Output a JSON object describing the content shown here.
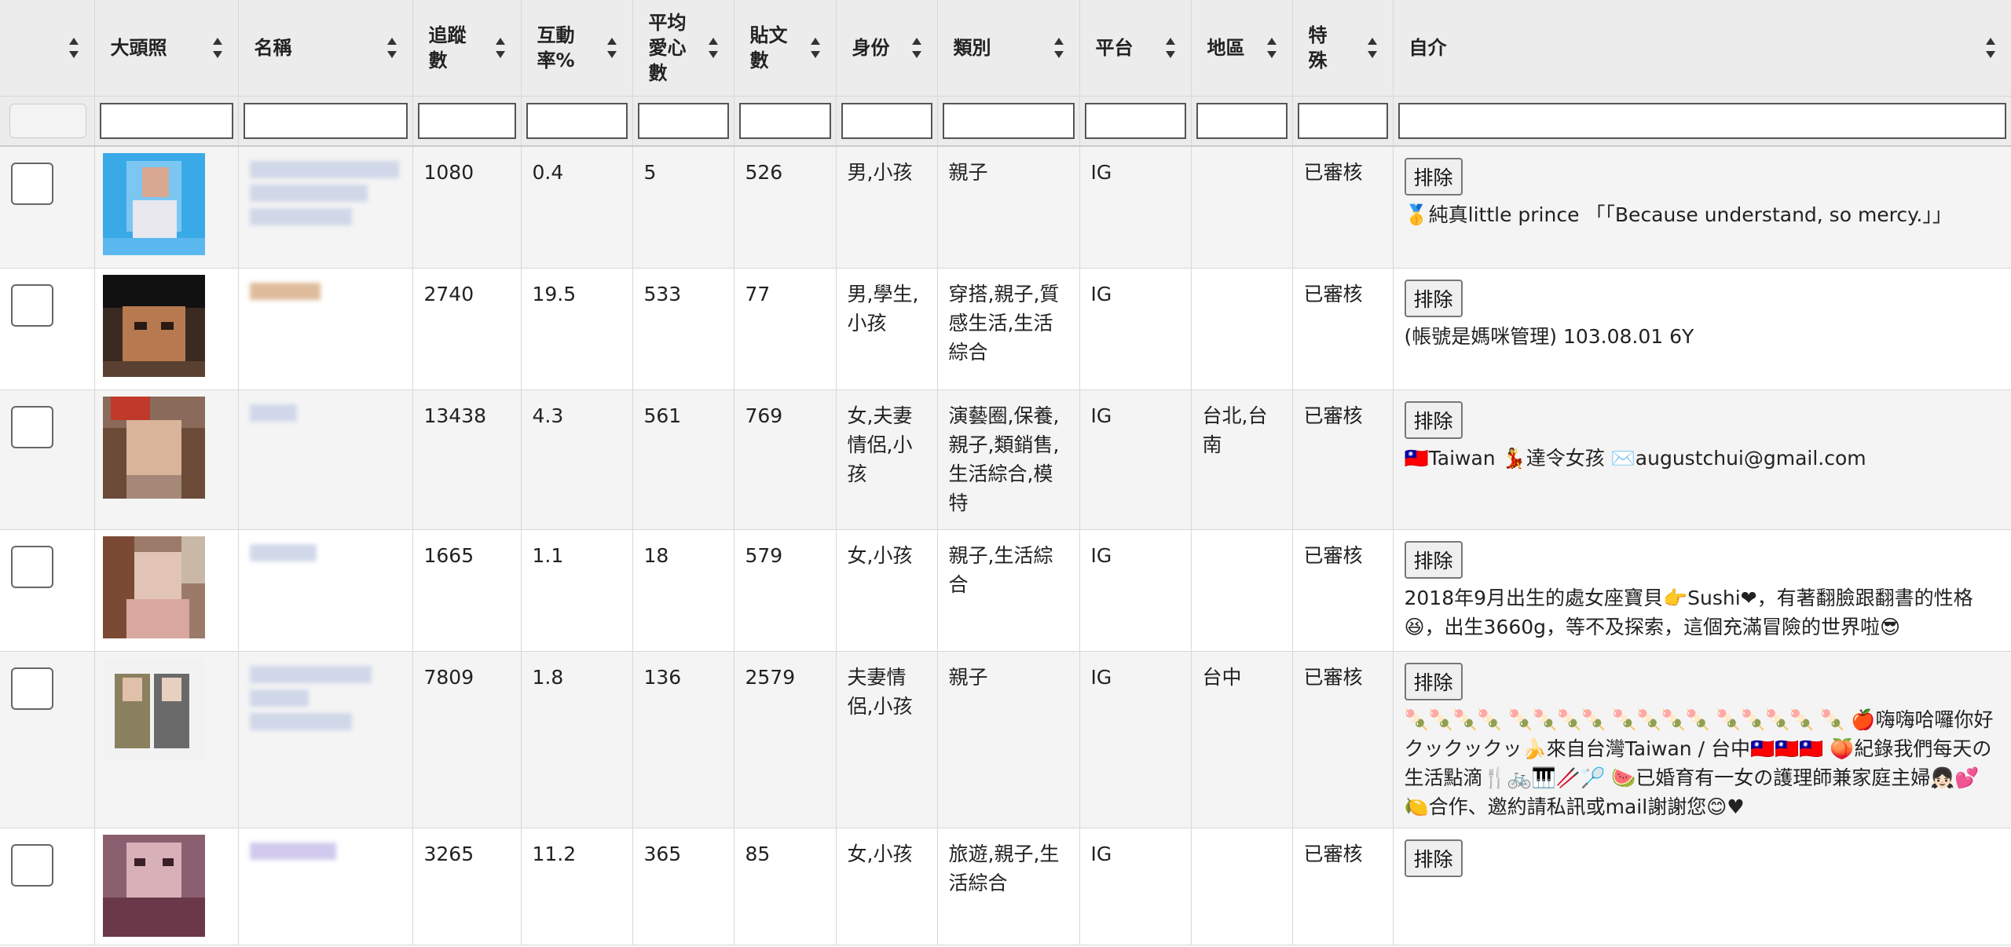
{
  "columns": {
    "avatar": "大頭照",
    "name": "名稱",
    "followers": "追蹤數",
    "engagement": "互動率%",
    "avg_likes": "平均愛心數",
    "posts": "貼文數",
    "identity": "身份",
    "category": "類別",
    "platform": "平台",
    "region": "地區",
    "special": "特殊",
    "bio": "自介"
  },
  "remove_label": "排除",
  "rows": [
    {
      "followers": "1080",
      "engagement": "0.4",
      "avg_likes": "5",
      "posts": "526",
      "identity": "男,小孩",
      "category": "親子",
      "platform": "IG",
      "region": "",
      "special": "已審核",
      "bio": "🥇純真little prince 「「Because understand, so mercy.」」"
    },
    {
      "followers": "2740",
      "engagement": "19.5",
      "avg_likes": "533",
      "posts": "77",
      "identity": "男,學生,小孩",
      "category": "穿搭,親子,質感生活,生活綜合",
      "platform": "IG",
      "region": "",
      "special": "已審核",
      "bio": "(帳號是媽咪管理) 103.08.01 6Y"
    },
    {
      "followers": "13438",
      "engagement": "4.3",
      "avg_likes": "561",
      "posts": "769",
      "identity": "女,夫妻情侶,小孩",
      "category": "演藝圈,保養,親子,類銷售,生活綜合,模特",
      "platform": "IG",
      "region": "台北,台南",
      "special": "已審核",
      "bio": "🇹🇼Taiwan 💃達令女孩 ✉️augustchui@gmail.com"
    },
    {
      "followers": "1665",
      "engagement": "1.1",
      "avg_likes": "18",
      "posts": "579",
      "identity": "女,小孩",
      "category": "親子,生活綜合",
      "platform": "IG",
      "region": "",
      "special": "已審核",
      "bio": "2018年9月出生的處女座寶貝👉Sushi❤，有著翻臉跟翻書的性格😆，出生3660g，等不及探索，這個充滿冒險的世界啦😎"
    },
    {
      "followers": "7809",
      "engagement": "1.8",
      "avg_likes": "136",
      "posts": "2579",
      "identity": "夫妻情侶,小孩",
      "category": "親子",
      "platform": "IG",
      "region": "台中",
      "special": "已審核",
      "bio": "🍡🍡🍡🍡 🍡🍡🍡🍡 🍡🍡🍡🍡 🍡🍡🍡🍡 🍡 🍎嗨嗨哈囉你好クックックッ🍌來自台灣Taiwan / 台中🇹🇼🇹🇼🇹🇼 🍑紀錄我們每天の生活點滴🍴🚲🎹🥢🏸 🍉已婚育有一女の護理師兼家庭主婦👧🏻💕 🍋合作、邀約請私訊或mail謝謝您😊♥"
    },
    {
      "followers": "3265",
      "engagement": "11.2",
      "avg_likes": "365",
      "posts": "85",
      "identity": "女,小孩",
      "category": "旅遊,親子,生活綜合",
      "platform": "IG",
      "region": "",
      "special": "已審核",
      "bio": ""
    }
  ]
}
